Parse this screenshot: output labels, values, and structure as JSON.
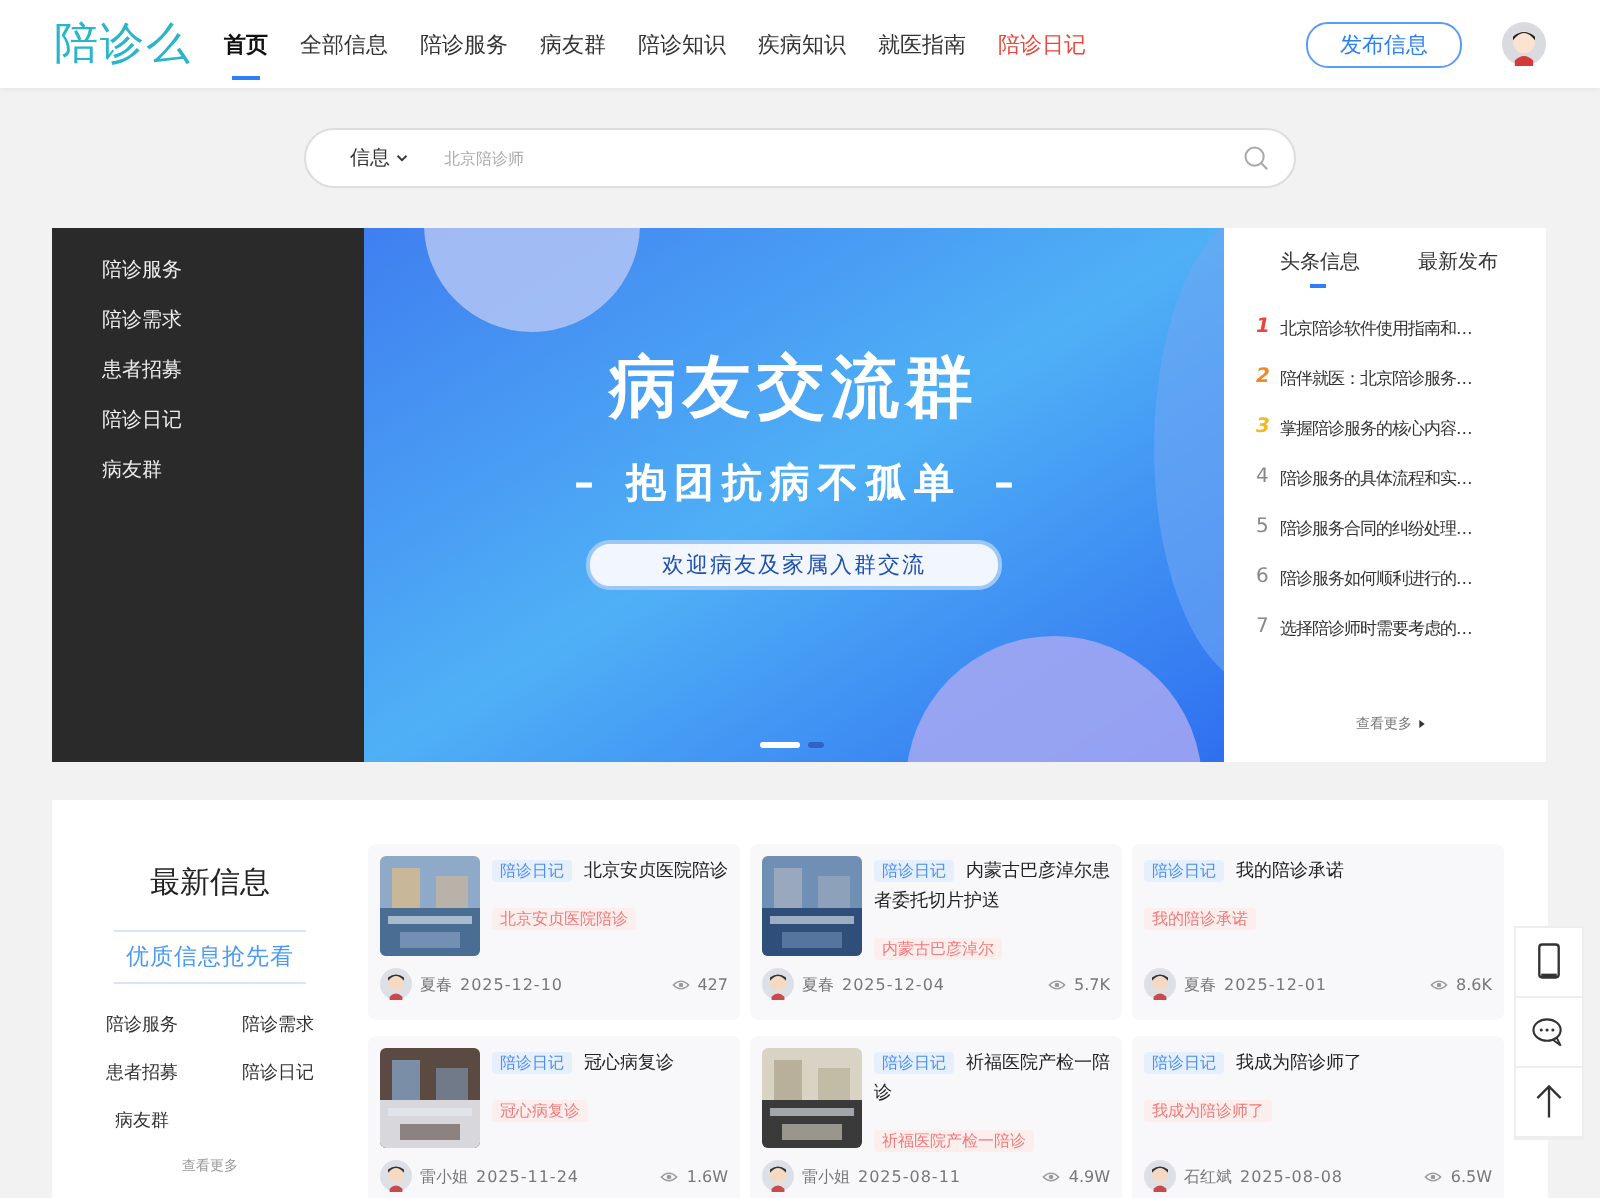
{
  "header": {
    "logo": "陪诊么",
    "nav": [
      {
        "label": "首页",
        "selected": true,
        "kind": "normal"
      },
      {
        "label": "全部信息",
        "selected": false,
        "kind": "normal"
      },
      {
        "label": "陪诊服务",
        "selected": false,
        "kind": "normal"
      },
      {
        "label": "病友群",
        "selected": false,
        "kind": "normal"
      },
      {
        "label": "陪诊知识",
        "selected": false,
        "kind": "normal"
      },
      {
        "label": "疾病知识",
        "selected": false,
        "kind": "normal"
      },
      {
        "label": "就医指南",
        "selected": false,
        "kind": "normal"
      },
      {
        "label": "陪诊日记",
        "selected": false,
        "kind": "highlight"
      }
    ],
    "publish_button": "发布信息"
  },
  "search": {
    "scope": "信息",
    "placeholder": "北京陪诊师"
  },
  "side_menu": [
    "陪诊服务",
    "陪诊需求",
    "患者招募",
    "陪诊日记",
    "病友群"
  ],
  "banner": {
    "title": "病友交流群",
    "subtitle": "抱团抗病不孤单",
    "dash_left": "–",
    "dash_right": "–",
    "pill": "欢迎病友及家属入群交流",
    "dots": [
      {
        "selected": true
      },
      {
        "selected": false
      }
    ]
  },
  "news": {
    "tabs": [
      {
        "label": "头条信息",
        "selected": true
      },
      {
        "label": "最新发布",
        "selected": false
      }
    ],
    "items": [
      {
        "rank": "1",
        "color": "#e8473b",
        "title": "北京陪诊软件使用指南和…"
      },
      {
        "rank": "2",
        "color": "#f08a24",
        "title": "陪伴就医：北京陪诊服务…"
      },
      {
        "rank": "3",
        "color": "#f5b820",
        "title": "掌握陪诊服务的核心内容…"
      },
      {
        "rank": "4",
        "color": "#888888",
        "title": "陪诊服务的具体流程和实…"
      },
      {
        "rank": "5",
        "color": "#888888",
        "title": "陪诊服务合同的纠纷处理…"
      },
      {
        "rank": "6",
        "color": "#888888",
        "title": "陪诊服务如何顺利进行的…"
      },
      {
        "rank": "7",
        "color": "#888888",
        "title": "选择陪诊师时需要考虑的…"
      }
    ],
    "more": "查看更多"
  },
  "latest": {
    "title": "最新信息",
    "slogan": "优质信息抢先看",
    "categories": [
      "陪诊服务",
      "陪诊需求",
      "患者招募",
      "陪诊日记",
      "病友群"
    ],
    "more": "查看更多"
  },
  "cards": [
    {
      "tag": "陪诊日记",
      "title": "北京安贞医院陪诊",
      "label": "北京安贞医院陪诊",
      "author": "夏春",
      "date": "2025-12-10",
      "views": "427",
      "has_picture": true
    },
    {
      "tag": "陪诊日记",
      "title": "内蒙古巴彦淖尔患者委托切片护送",
      "label": "内蒙古巴彦淖尔",
      "author": "夏春",
      "date": "2025-12-04",
      "views": "5.7K",
      "has_picture": true
    },
    {
      "tag": "陪诊日记",
      "title": "我的陪诊承诺",
      "label": "我的陪诊承诺",
      "author": "夏春",
      "date": "2025-12-01",
      "views": "8.6K",
      "has_picture": false
    },
    {
      "tag": "陪诊日记",
      "title": "冠心病复诊",
      "label": "冠心病复诊",
      "author": "雷小姐",
      "date": "2025-11-24",
      "views": "1.6W",
      "has_picture": true
    },
    {
      "tag": "陪诊日记",
      "title": "祈福医院产检一陪诊",
      "label": "祈福医院产检一陪诊",
      "author": "雷小姐",
      "date": "2025-08-11",
      "views": "4.9W",
      "has_picture": true
    },
    {
      "tag": "陪诊日记",
      "title": "我成为陪诊师了",
      "label": "我成为陪诊师了",
      "author": "石红斌",
      "date": "2025-08-08",
      "views": "6.5W",
      "has_picture": false
    }
  ]
}
